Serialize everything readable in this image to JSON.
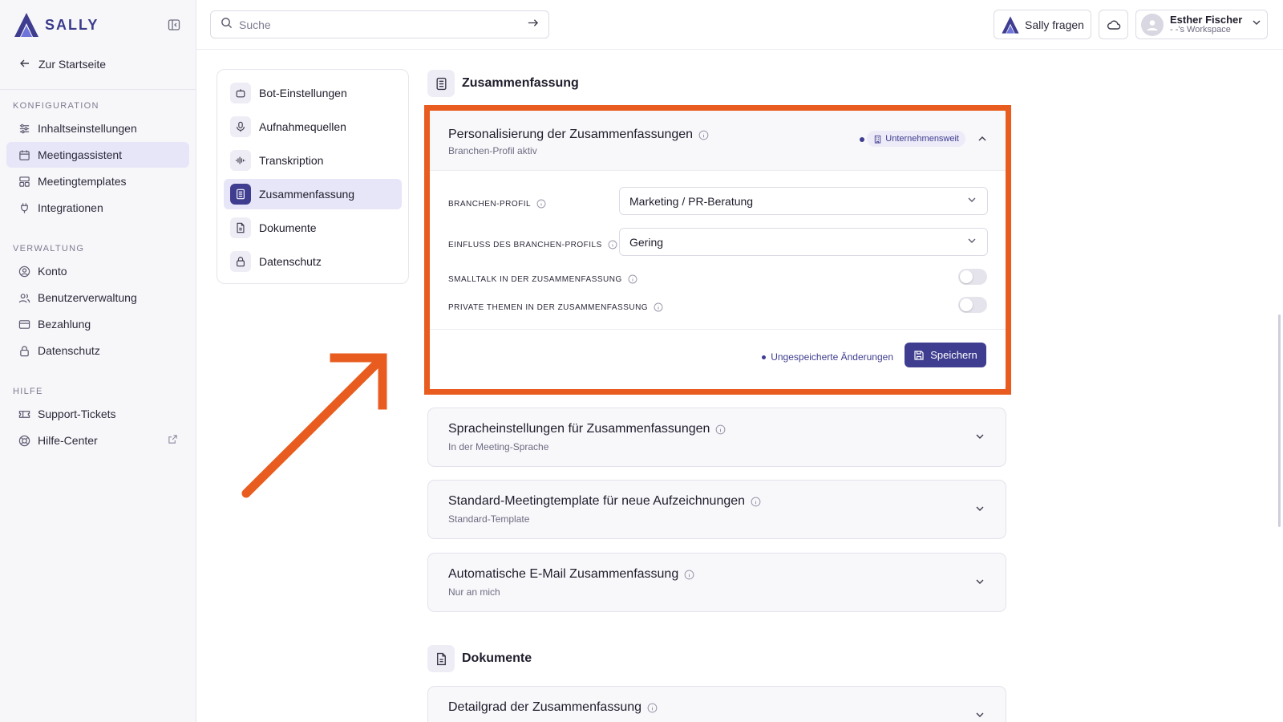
{
  "brand": {
    "name": "SALLY"
  },
  "sidebar": {
    "back_label": "Zur Startseite",
    "sections": [
      {
        "title": "KONFIGURATION",
        "items": [
          {
            "label": "Inhaltseinstellungen",
            "icon": "sliders-icon"
          },
          {
            "label": "Meetingassistent",
            "icon": "calendar-icon",
            "active": true
          },
          {
            "label": "Meetingtemplates",
            "icon": "template-icon"
          },
          {
            "label": "Integrationen",
            "icon": "plug-icon"
          }
        ]
      },
      {
        "title": "VERWALTUNG",
        "items": [
          {
            "label": "Konto",
            "icon": "user-circle-icon"
          },
          {
            "label": "Benutzerverwaltung",
            "icon": "users-icon"
          },
          {
            "label": "Bezahlung",
            "icon": "credit-card-icon"
          },
          {
            "label": "Datenschutz",
            "icon": "lock-icon"
          }
        ]
      },
      {
        "title": "HILFE",
        "items": [
          {
            "label": "Support-Tickets",
            "icon": "ticket-icon"
          },
          {
            "label": "Hilfe-Center",
            "icon": "lifebuoy-icon"
          }
        ]
      }
    ]
  },
  "topbar": {
    "search_placeholder": "Suche",
    "ask_label": "Sally fragen",
    "user_name": "Esther Fischer",
    "workspace": "- -'s Workspace"
  },
  "settings_nav": [
    {
      "label": "Bot-Einstellungen",
      "icon": "bot-icon"
    },
    {
      "label": "Aufnahmequellen",
      "icon": "microphone-icon"
    },
    {
      "label": "Transkription",
      "icon": "waveform-icon"
    },
    {
      "label": "Zusammenfassung",
      "icon": "summary-icon",
      "active": true
    },
    {
      "label": "Dokumente",
      "icon": "document-icon"
    },
    {
      "label": "Datenschutz",
      "icon": "lock-icon"
    }
  ],
  "main": {
    "section1_title": "Zusammenfassung",
    "open_card": {
      "title": "Personalisierung der Zusammenfassungen",
      "subtitle": "Branchen-Profil aktiv",
      "badge": "Unternehmensweit",
      "fields": [
        {
          "label": "BRANCHEN-PROFIL",
          "value": "Marketing / PR-Beratung"
        },
        {
          "label": "EINFLUSS DES BRANCHEN-PROFILS",
          "value": "Gering"
        }
      ],
      "toggles": [
        {
          "label": "SMALLTALK IN DER ZUSAMMENFASSUNG",
          "on": false
        },
        {
          "label": "PRIVATE THEMEN IN DER ZUSAMMENFASSUNG",
          "on": false
        }
      ],
      "unsaved_label": "Ungespeicherte Änderungen",
      "save_label": "Speichern"
    },
    "cards": [
      {
        "title": "Spracheinstellungen für Zusammenfassungen",
        "subtitle": "In der Meeting-Sprache"
      },
      {
        "title": "Standard-Meetingtemplate für neue Aufzeichnungen",
        "subtitle": "Standard-Template"
      },
      {
        "title": "Automatische E-Mail Zusammenfassung",
        "subtitle": "Nur an mich"
      }
    ],
    "section2_title": "Dokumente",
    "doc_card": {
      "title": "Detailgrad der Zusammenfassung"
    }
  },
  "colors": {
    "accent": "#3f3d8f",
    "highlight": "#e85d1f",
    "active_bg": "#e7e6f8"
  }
}
